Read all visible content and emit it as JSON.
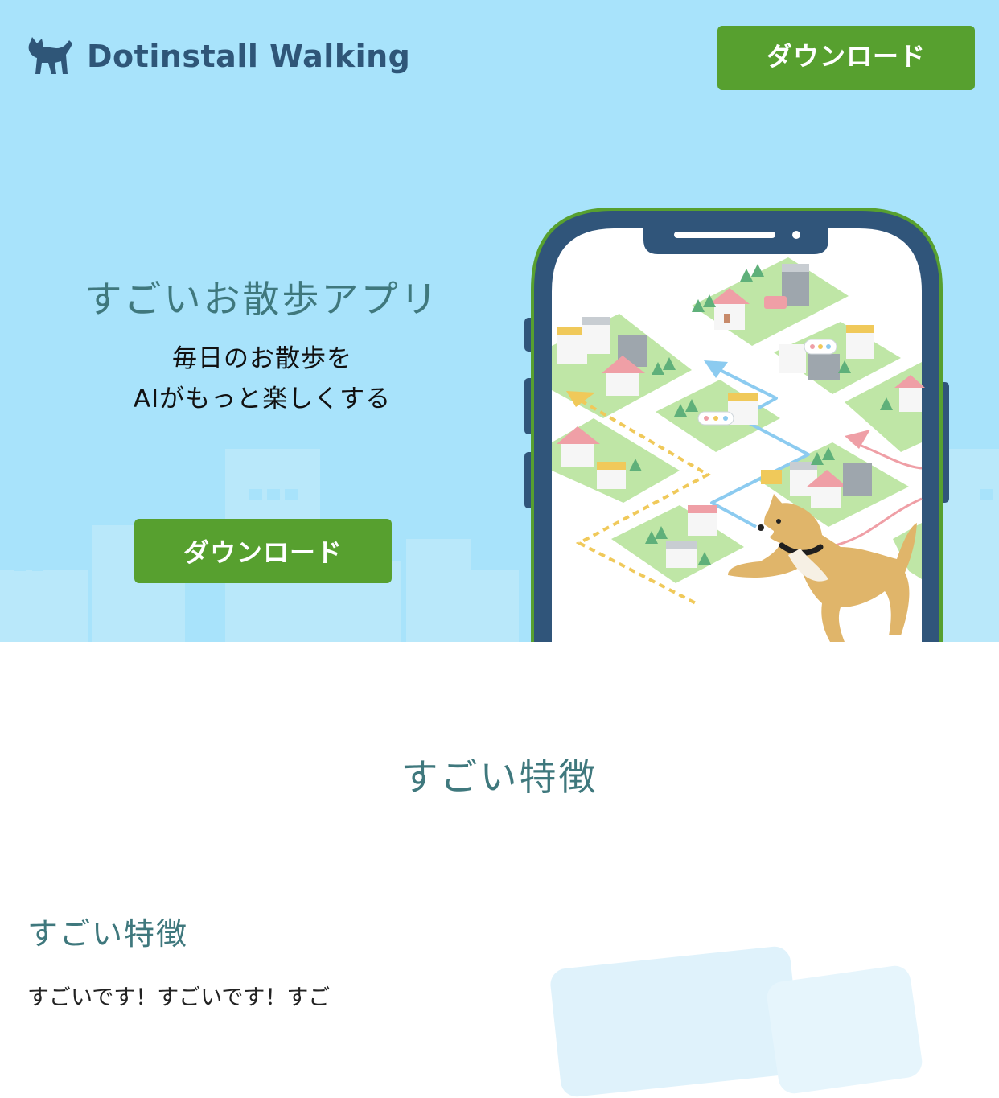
{
  "header": {
    "brand_name": "Dotinstall Walking",
    "download_label": "ダウンロード"
  },
  "hero": {
    "title": "すごいお散歩アプリ",
    "subtitle_line1": "毎日のお散歩を",
    "subtitle_line2": "AIがもっと楽しくする",
    "download_label": "ダウンロード"
  },
  "features": {
    "section_title": "すごい特徴",
    "item_title": "すごい特徴",
    "item_text": "すごいです！すごいです！すご"
  },
  "colors": {
    "hero_bg": "#a8e3fb",
    "brand_text": "#2f5678",
    "button_green": "#57a02f",
    "heading_teal": "#3f787d",
    "phone_frame": "#30557a",
    "phone_outline": "#57a02f"
  },
  "icons": {
    "logo": "dog-silhouette-icon",
    "illustration": "phone-map-dog-illustration"
  }
}
